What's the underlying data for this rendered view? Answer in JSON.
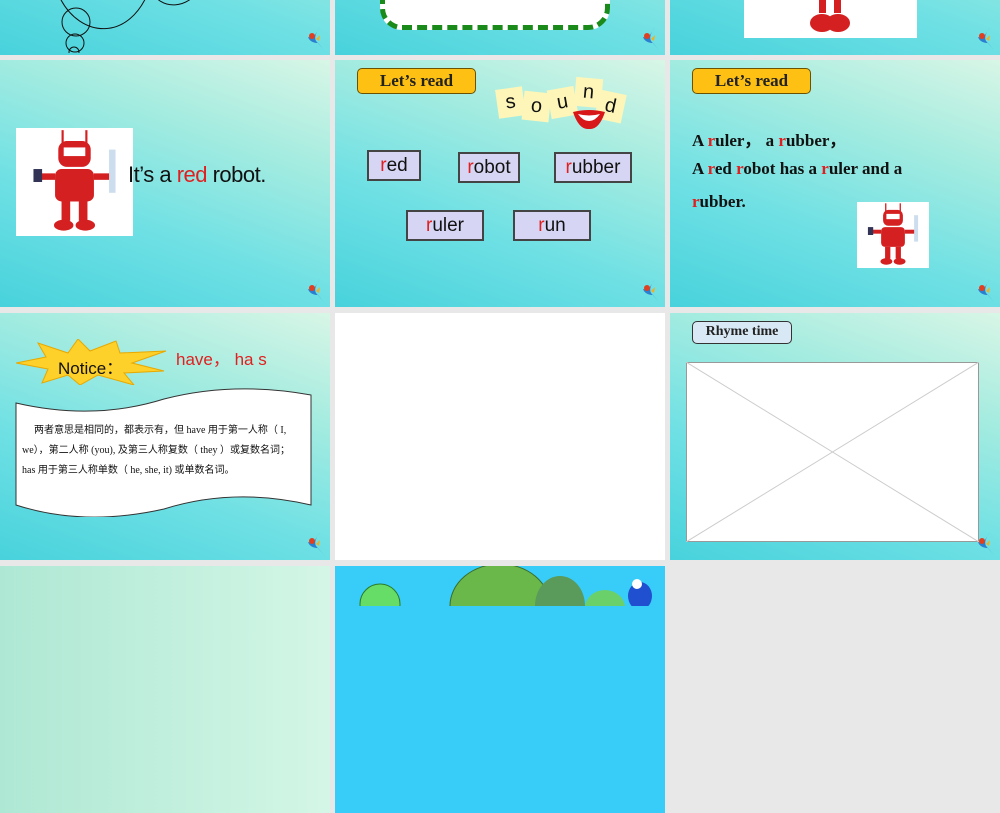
{
  "slides": [
    {
      "id": "slide-top-1"
    },
    {
      "id": "slide-top-2"
    },
    {
      "id": "slide-top-3"
    },
    {
      "id": "slide-robot",
      "text_pre": "It’s a ",
      "text_red": "red",
      "text_post": " robot."
    },
    {
      "id": "slide-sound",
      "tag": "Let’s read",
      "sound_letters": [
        "s",
        "o",
        "u",
        "n",
        "d"
      ],
      "words": [
        {
          "first": "r",
          "rest": "ed"
        },
        {
          "first": "r",
          "rest": "obot"
        },
        {
          "first": "r",
          "rest": "ubber"
        },
        {
          "first": "r",
          "rest": "uler"
        },
        {
          "first": "r",
          "rest": "un"
        }
      ]
    },
    {
      "id": "slide-read",
      "tag": "Let’s read",
      "line1": [
        {
          "t": "A "
        },
        {
          "t": "r",
          "red": true
        },
        {
          "t": "uler，  a "
        },
        {
          "t": "r",
          "red": true
        },
        {
          "t": "ubber，"
        }
      ],
      "line2": [
        {
          "t": "A "
        },
        {
          "t": "r",
          "red": true
        },
        {
          "t": "ed "
        },
        {
          "t": "r",
          "red": true
        },
        {
          "t": "obot has a "
        },
        {
          "t": "r",
          "red": true
        },
        {
          "t": "uler and a"
        }
      ],
      "line3": [
        {
          "t": "r",
          "red": true
        },
        {
          "t": "ubber."
        }
      ]
    },
    {
      "id": "slide-notice",
      "notice": "Notice：",
      "title_red": "have， ha s",
      "body": "两者意思是相同的，都表示有，但 have 用于第一人称（ I, we），第二人称 (you), 及第三人称复数（ they ）或复数名词； has 用于第三人称单数（ he, she, it) 或单数名词。"
    },
    {
      "id": "slide-blank"
    },
    {
      "id": "slide-rhyme",
      "tag": "Rhyme time"
    }
  ],
  "colors": {
    "accent_red": "#e02020",
    "tag_yellow": "#fec013",
    "gap": "#e8e8e8"
  }
}
